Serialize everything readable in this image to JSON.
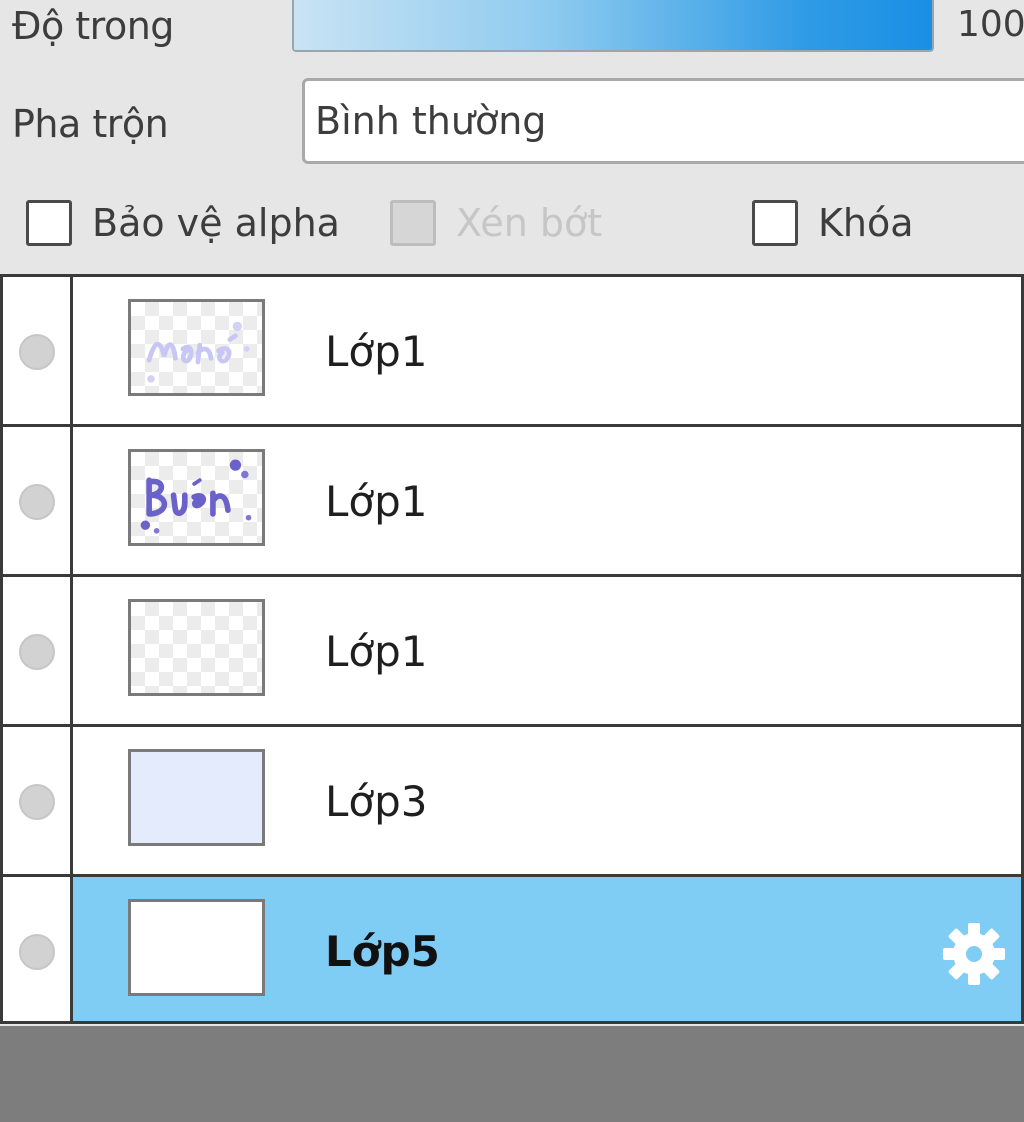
{
  "properties": {
    "opacity_label": "Độ trong",
    "opacity_value": "100",
    "opacity_fraction": 1.0,
    "blend_label": "Pha trộn",
    "blend_value": "Bình thường",
    "checkboxes": [
      {
        "label": "Bảo vệ alpha",
        "checked": false,
        "disabled": false
      },
      {
        "label": "Xén bớt",
        "checked": false,
        "disabled": true
      },
      {
        "label": "Khóa",
        "checked": false,
        "disabled": false
      }
    ]
  },
  "layers": [
    {
      "name": "Lớp1",
      "thumbnail": "faint-lavender-lettering",
      "selected": false
    },
    {
      "name": "Lớp1",
      "thumbnail": "purple-lettering-with-dots",
      "selected": false
    },
    {
      "name": "Lớp1",
      "thumbnail": "transparent",
      "selected": false
    },
    {
      "name": "Lớp3",
      "thumbnail": "light-lavender-fill",
      "selected": false
    },
    {
      "name": "Lớp5",
      "thumbnail": "white-fill",
      "selected": true,
      "icon": "gear-icon"
    }
  ],
  "colors": {
    "selected_row": "#7fcdf4",
    "opacity_fill": "#1a8fe3",
    "bottom_bar": "#7d7d7d"
  }
}
